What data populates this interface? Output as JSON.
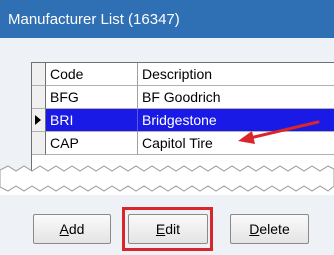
{
  "window": {
    "title": "Manufacturer List (16347)"
  },
  "grid": {
    "columns": [
      "Code",
      "Description"
    ],
    "rows": [
      {
        "code": "BFG",
        "description": "BF Goodrich",
        "selected": false
      },
      {
        "code": "BRI",
        "description": "Bridgestone",
        "selected": true
      },
      {
        "code": "CAP",
        "description": "Capitol Tire",
        "selected": false
      }
    ]
  },
  "buttons": {
    "add": {
      "label": "Add",
      "mnemonic": "A",
      "rest": "dd"
    },
    "edit": {
      "label": "Edit",
      "mnemonic": "E",
      "rest": "dit"
    },
    "delete": {
      "label": "Delete",
      "mnemonic": "D",
      "rest": "elete"
    }
  },
  "colors": {
    "title_bar": "#2f6fb4",
    "selection": "#1a1ae6",
    "annotation": "#d9262b"
  },
  "icons": {
    "row_pointer": "row-pointer-icon",
    "annotation_arrow": "annotation-arrow-icon"
  }
}
